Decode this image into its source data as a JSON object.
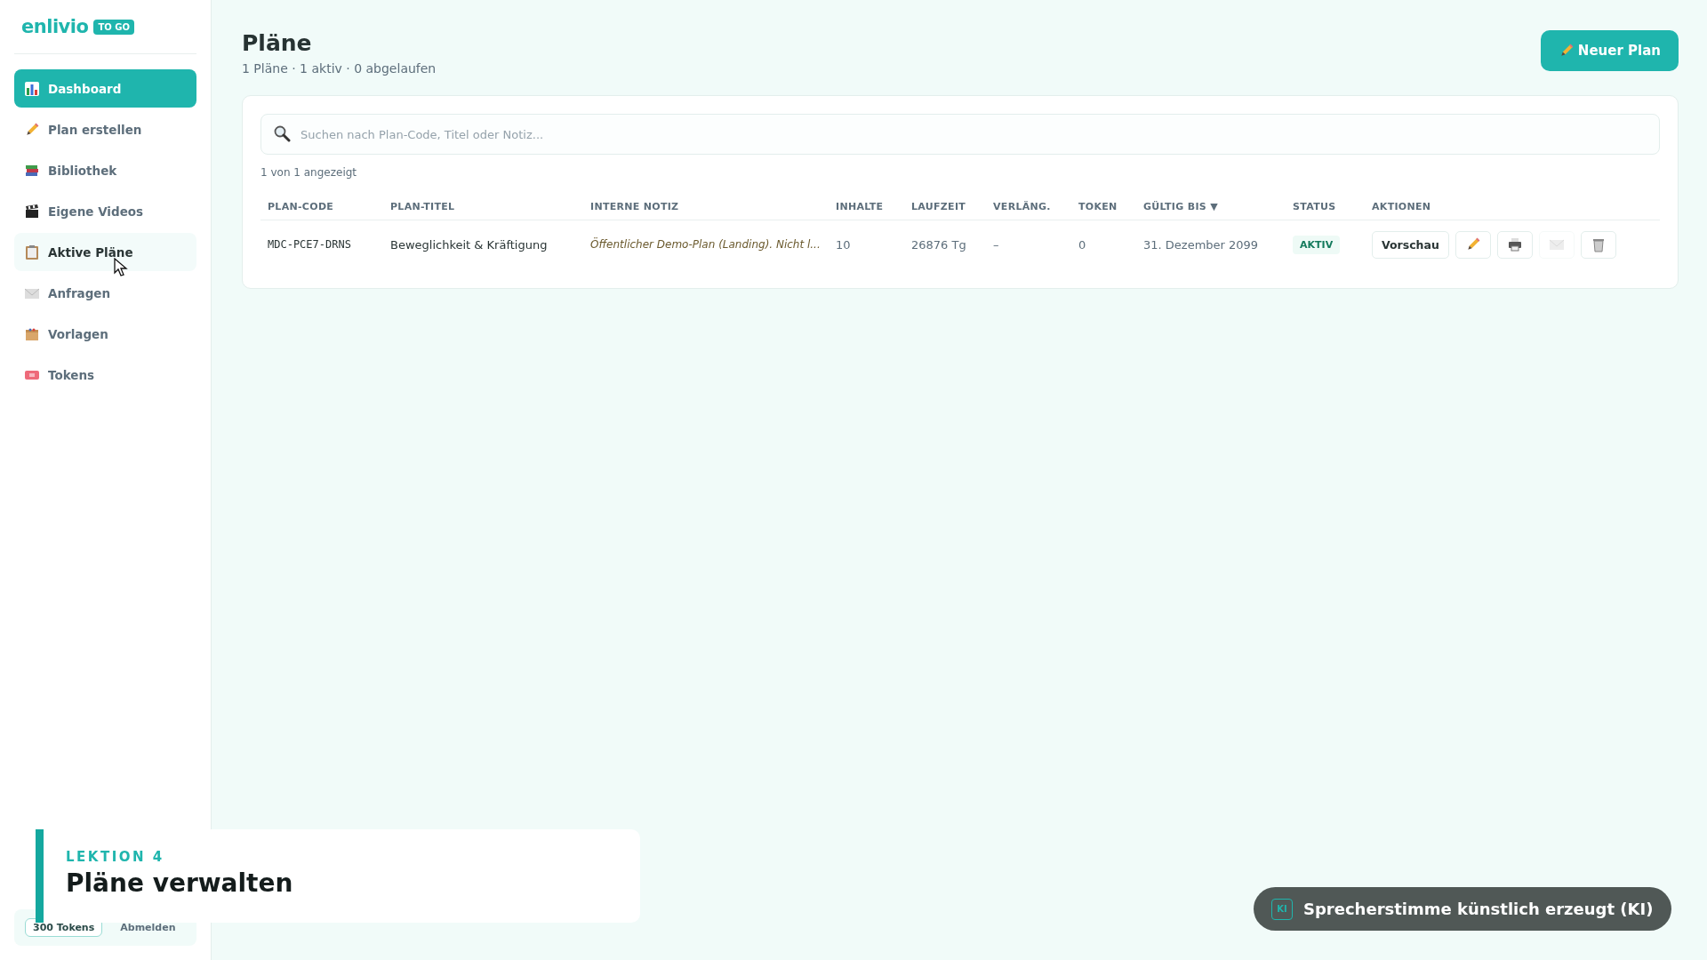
{
  "logo": {
    "name": "enlivio",
    "badge": "TO GO"
  },
  "sidebar": {
    "items": [
      {
        "label": "Dashboard",
        "selected": true,
        "hovered": false
      },
      {
        "label": "Plan erstellen",
        "selected": false,
        "hovered": false
      },
      {
        "label": "Bibliothek",
        "selected": false,
        "hovered": false
      },
      {
        "label": "Eigene Videos",
        "selected": false,
        "hovered": false
      },
      {
        "label": "Aktive Pläne",
        "selected": false,
        "hovered": true
      },
      {
        "label": "Anfragen",
        "selected": false,
        "hovered": false
      },
      {
        "label": "Vorlagen",
        "selected": false,
        "hovered": false
      },
      {
        "label": "Tokens",
        "selected": false,
        "hovered": false
      }
    ],
    "footer": {
      "tokens": "300 Tokens",
      "logout": "Abmelden"
    }
  },
  "header": {
    "title": "Pläne",
    "summary": "1 Pläne · 1 aktiv · 0 abgelaufen",
    "new_button": "Neuer Plan"
  },
  "search": {
    "placeholder": "Suchen nach Plan-Code, Titel oder Notiz..."
  },
  "count": "1 von 1 angezeigt",
  "table": {
    "columns": [
      {
        "label": "PLAN-CODE"
      },
      {
        "label": "PLAN-TITEL"
      },
      {
        "label": "INTERNE NOTIZ"
      },
      {
        "label": "INHALTE"
      },
      {
        "label": "LAUFZEIT"
      },
      {
        "label": "VERLÄNG."
      },
      {
        "label": "TOKEN"
      },
      {
        "label": "GÜLTIG BIS",
        "sort_indicator": "▼"
      },
      {
        "label": "STATUS"
      },
      {
        "label": "AKTIONEN"
      }
    ],
    "rows": [
      {
        "code": "MDC-PCE7-DRNS",
        "title": "Beweglichkeit & Kräftigung",
        "note": "Öffentlicher Demo-Plan (Landing). Nicht l...",
        "contents": "10",
        "duration": "26876 Tg",
        "extension": "–",
        "token": "0",
        "valid_until": "31. Dezember 2099",
        "status": "AKTIV",
        "actions": [
          {
            "kind": "text",
            "label": "Vorschau",
            "disabled": false
          },
          {
            "kind": "edit",
            "disabled": false
          },
          {
            "kind": "print",
            "disabled": false
          },
          {
            "kind": "mail",
            "disabled": true
          },
          {
            "kind": "delete",
            "disabled": false
          }
        ]
      }
    ]
  },
  "lesson": {
    "label": "LEKTION 4",
    "title": "Pläne verwalten"
  },
  "ai_notice": {
    "badge": "KI",
    "text": "Sprecherstimme künstlich erzeugt (KI)"
  }
}
